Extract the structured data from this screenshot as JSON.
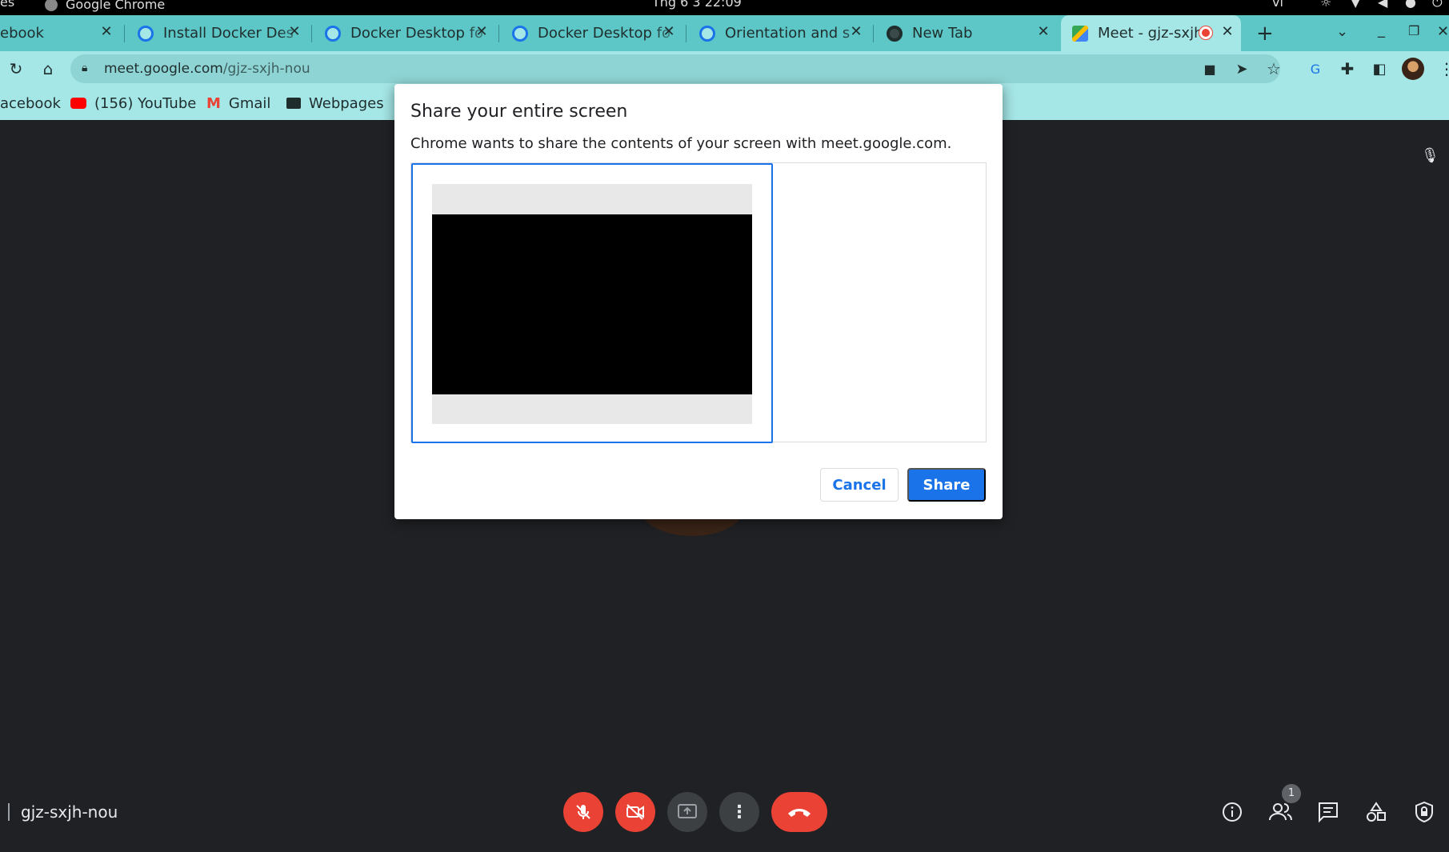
{
  "os_bar": {
    "left_fragment": "es",
    "app_name": "Google Chrome",
    "clock": "Thg 6 3  22:09",
    "lang": "vi"
  },
  "tabs": [
    {
      "label": "ebook",
      "favicon": "facebook-icon"
    },
    {
      "label": "Install Docker Des",
      "favicon": "docker-icon"
    },
    {
      "label": "Docker Desktop fo",
      "favicon": "docker-icon"
    },
    {
      "label": "Docker Desktop fo",
      "favicon": "docker-icon"
    },
    {
      "label": "Orientation and s",
      "favicon": "docker-icon"
    },
    {
      "label": "New Tab",
      "favicon": "chrome-icon"
    },
    {
      "label": "Meet - gjz-sxjh",
      "favicon": "meet-icon",
      "active": true,
      "recording": true
    }
  ],
  "address_bar": {
    "host": "meet.google.com",
    "path": "/gjz-sxjh-nou"
  },
  "bookmarks": [
    {
      "label": "acebook",
      "icon": "facebook-icon"
    },
    {
      "label": "(156) YouTube",
      "icon": "youtube-icon"
    },
    {
      "label": "Gmail",
      "icon": "gmail-icon"
    },
    {
      "label": "Webpages",
      "icon": "folder-icon"
    }
  ],
  "dialog": {
    "title": "Share your entire screen",
    "description": "Chrome wants to share the contents of your screen with meet.google.com.",
    "cancel_label": "Cancel",
    "share_label": "Share"
  },
  "meet": {
    "meeting_code": "gjz-sxjh-nou",
    "participant_count": "1"
  },
  "colors": {
    "tab_strip": "#5dc6c6",
    "toolbar": "#a5e6e6",
    "accent": "#1a73e8",
    "danger": "#ea4335",
    "meet_bg": "#202124"
  }
}
